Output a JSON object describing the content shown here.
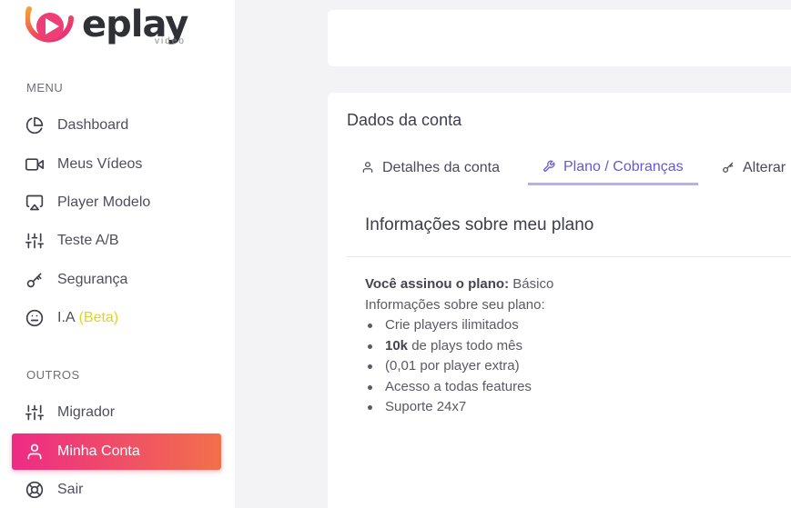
{
  "brand": {
    "name": "eplay",
    "sub": "video"
  },
  "sidebar": {
    "menu_title": "MENU",
    "menu_items": [
      {
        "label": "Dashboard",
        "icon": "pie-chart-icon"
      },
      {
        "label": "Meus Vídeos",
        "icon": "video-camera-icon"
      },
      {
        "label": "Player Modelo",
        "icon": "airplay-icon"
      },
      {
        "label": "Teste A/B",
        "icon": "sliders-icon"
      },
      {
        "label": "Segurança",
        "icon": "key-icon"
      },
      {
        "label": "I.A",
        "badge": "(Beta)",
        "icon": "smile-icon"
      }
    ],
    "others_title": "OUTROS",
    "other_items": [
      {
        "label": "Migrador",
        "icon": "sliders-icon"
      },
      {
        "label": "Minha Conta",
        "icon": "user-icon",
        "active": true
      },
      {
        "label": "Sair",
        "icon": "lifebuoy-icon"
      }
    ]
  },
  "account": {
    "title": "Dados da conta",
    "tabs": [
      {
        "label": "Detalhes da conta",
        "icon": "user-icon"
      },
      {
        "label": "Plano / Cobranças",
        "icon": "tool-icon",
        "active": true
      },
      {
        "label": "Alterar",
        "icon": "key-icon"
      }
    ],
    "plan_heading": "Informações sobre meu plano",
    "subscribed_label": "Você assinou o plano:",
    "plan_name": "Básico",
    "info_label": "Informações sobre seu plano:",
    "features": {
      "f1": "Crie players ilimitados",
      "f2_bold": "10k",
      "f2_rest": "de plays todo mês",
      "f3": "(0,01 por player extra)",
      "f4": "Acesso a todas features",
      "f5": "Suporte 24x7"
    }
  },
  "colors": {
    "active_gradient_start": "#ee2a86",
    "active_gradient_end": "#f2704a",
    "tab_active": "#6658d3",
    "beta": "#e3d41e"
  }
}
